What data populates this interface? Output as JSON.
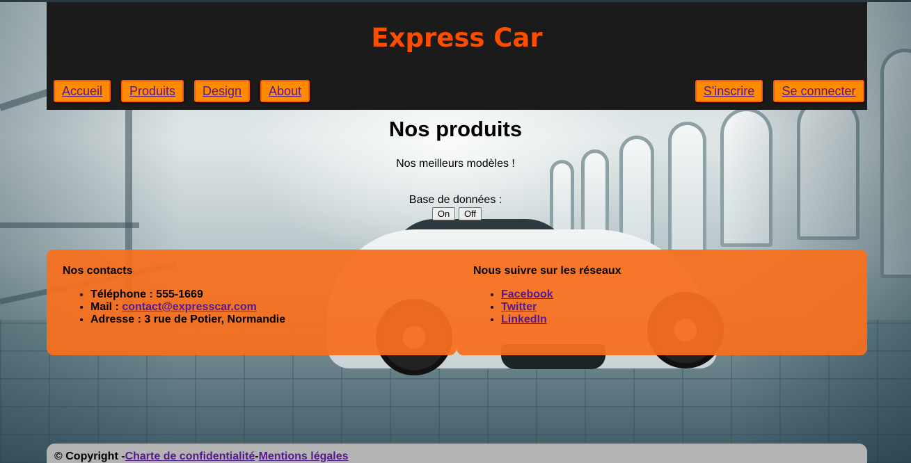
{
  "site": {
    "title": "Express Car"
  },
  "nav": {
    "left": [
      "Accueil",
      "Produits",
      "Design",
      "About"
    ],
    "right": [
      "S'inscrire",
      "Se connecter"
    ]
  },
  "main": {
    "title": "Nos produits",
    "subtitle": "Nos meilleurs modèles !",
    "db_label": "Base de données :",
    "db_on": "On",
    "db_off": "Off"
  },
  "contacts": {
    "heading": "Nos contacts",
    "phone_label": "Téléphone : 555-1669",
    "mail_label": "Mail : ",
    "mail_link": "contact@expresscar.com",
    "address": "Adresse : 3 rue de Potier, Normandie"
  },
  "social": {
    "heading": "Nous suivre sur les réseaux",
    "links": [
      "Facebook",
      "Twitter",
      "LinkedIn"
    ]
  },
  "footer": {
    "copyright": "© Copyright -",
    "privacy": "Charte de confidentialité",
    "separator": "-",
    "legal": "Mentions légales"
  },
  "colors": {
    "brand": "#ff4d00",
    "nav_button": "#ff8c00",
    "panel": "#f7701e",
    "header_bg": "#1b1b1b",
    "link": "#551a8b"
  }
}
